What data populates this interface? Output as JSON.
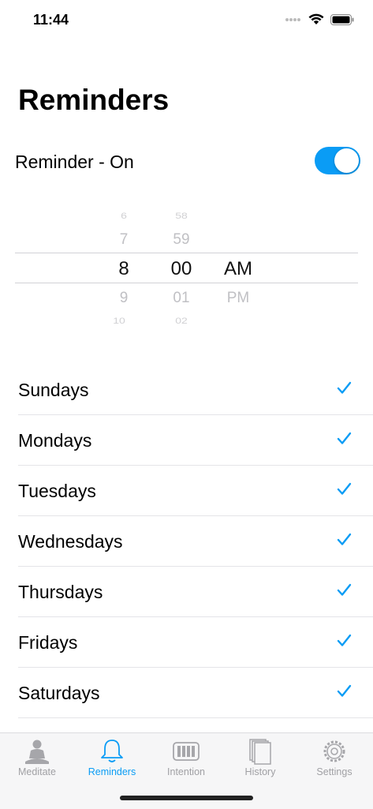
{
  "status_bar": {
    "time": "11:44"
  },
  "title": "Reminders",
  "reminder_toggle": {
    "label": "Reminder - On",
    "on": true
  },
  "time_picker": {
    "hours": [
      "6",
      "7",
      "8",
      "9",
      "10"
    ],
    "minutes": [
      "58",
      "59",
      "00",
      "01",
      "02"
    ],
    "periods": [
      "AM",
      "PM"
    ],
    "selected": {
      "hour": "8",
      "minute": "00",
      "period": "AM"
    }
  },
  "days": [
    {
      "label": "Sundays",
      "checked": true
    },
    {
      "label": "Mondays",
      "checked": true
    },
    {
      "label": "Tuesdays",
      "checked": true
    },
    {
      "label": "Wednesdays",
      "checked": true
    },
    {
      "label": "Thursdays",
      "checked": true
    },
    {
      "label": "Fridays",
      "checked": true
    },
    {
      "label": "Saturdays",
      "checked": true
    }
  ],
  "tabs": [
    {
      "label": "Meditate",
      "icon": "meditate-icon"
    },
    {
      "label": "Reminders",
      "icon": "bell-icon",
      "active": true
    },
    {
      "label": "Intention",
      "icon": "intention-icon"
    },
    {
      "label": "History",
      "icon": "history-icon"
    },
    {
      "label": "Settings",
      "icon": "gear-icon"
    }
  ],
  "colors": {
    "accent": "#0a9cf5",
    "inactive": "#a0a0a4"
  }
}
